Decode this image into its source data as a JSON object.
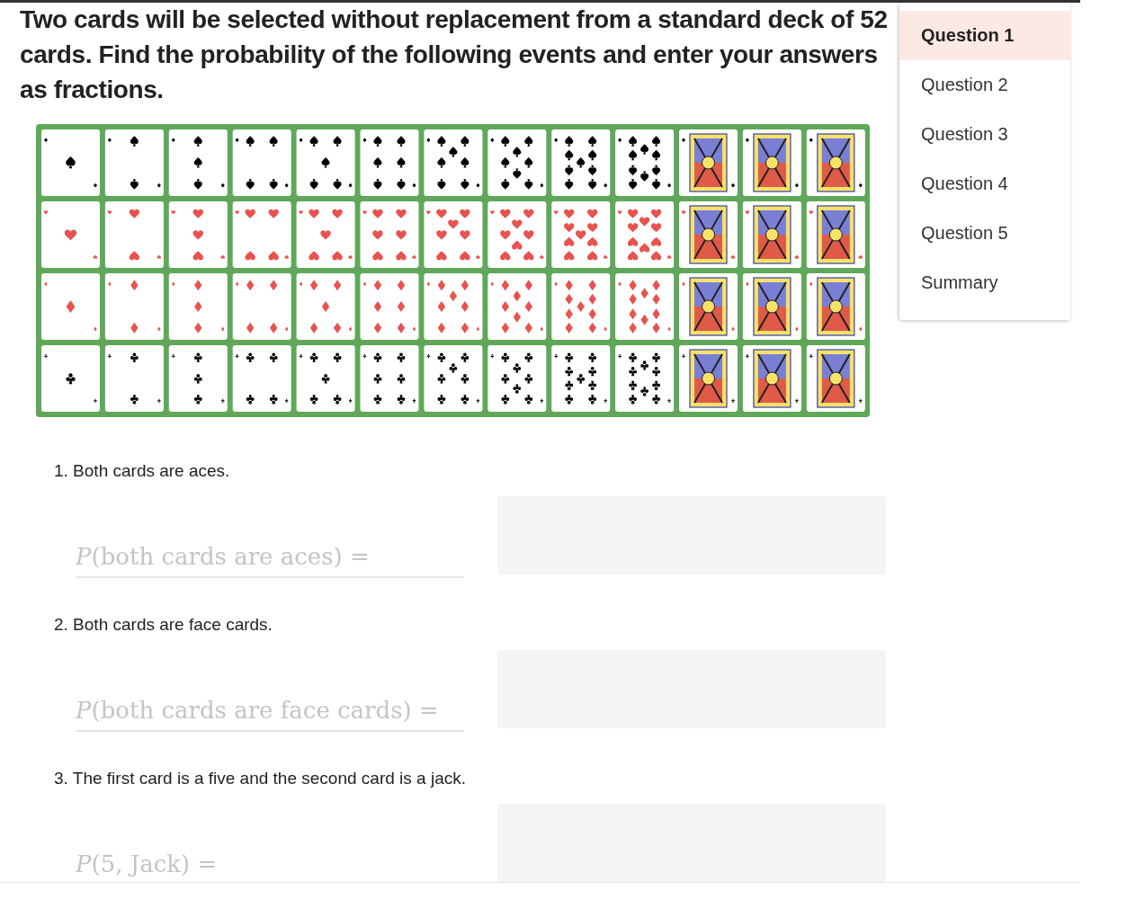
{
  "intro": "Two cards will be selected without replacement from a standard deck of 52 cards. Find the probability of the following events and enter your answers as fractions.",
  "questions": [
    {
      "number": "1.",
      "text": "Both cards are aces.",
      "placeholder": "*P*(both cards are aces) ="
    },
    {
      "number": "2.",
      "text": "Both cards are face cards.",
      "placeholder": "*P*(both cards are face cards) ="
    },
    {
      "number": "3.",
      "text": "The first card is a five and the second card is a jack.",
      "placeholder": "*P*(5, Jack) ="
    }
  ],
  "sidebar": {
    "items": [
      {
        "label": "Question 1",
        "selected": true
      },
      {
        "label": "Question 2",
        "selected": false
      },
      {
        "label": "Question 3",
        "selected": false
      },
      {
        "label": "Question 4",
        "selected": false
      },
      {
        "label": "Question 5",
        "selected": false
      },
      {
        "label": "Summary",
        "selected": false
      }
    ]
  }
}
